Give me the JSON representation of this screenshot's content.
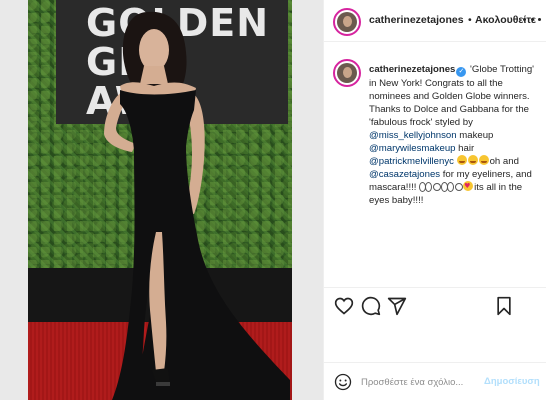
{
  "post": {
    "username": "catherinezetajones",
    "follow_separator": "•",
    "follow_label": "Ακολουθείτε",
    "photo": {
      "sign_text": "GOLDEN\nGLO\nAW"
    },
    "caption": {
      "username": "catherinezetajones",
      "text_1": " 'Globe Trotting' in New York! Congrats to all the nominees and Golden Globe winners. Thanks to Dolce and Gabbana for the 'fabulous frock' styled by ",
      "mention_1": "@miss_kellyjohnson",
      "text_2": " makeup ",
      "mention_2": "@marywilesmakeup",
      "text_3": " hair ",
      "mention_3": "@patrickmelvillenyc",
      "text_4": "oh and ",
      "mention_4": "@casazetajones",
      "text_5": " for my eyeliners, and mascara!!!! ",
      "text_6": "its all in the eyes baby!!!!"
    },
    "comment": {
      "placeholder": "Προσθέστε ένα σχόλιο...",
      "post_label": "Δημοσίευση"
    },
    "icons": {
      "like": "heart-icon",
      "comment": "comment-icon",
      "share": "share-icon",
      "save": "bookmark-icon",
      "emoji": "smiley-icon",
      "more": "more-icon"
    },
    "colors": {
      "link": "#00376b",
      "post_button_disabled": "#b2dffc",
      "story_ring": "#d6249f",
      "verified": "#3897f0"
    }
  }
}
